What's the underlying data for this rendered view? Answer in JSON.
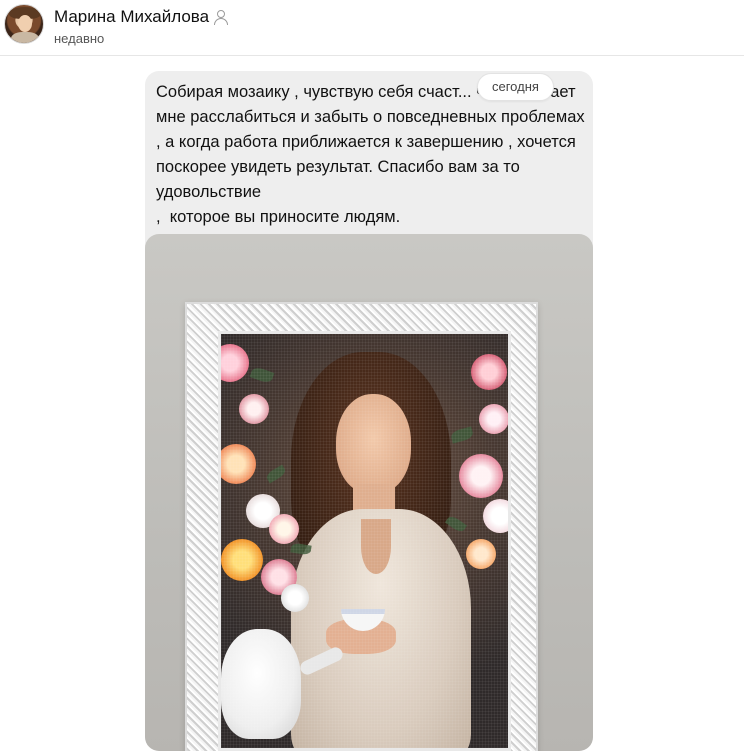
{
  "header": {
    "user_name": "Марина Михайлова",
    "status": "недавно"
  },
  "message": {
    "text": "Собирая мозаику , чувствую себя счаст... что помогает мне расслабиться и забыть о повседневных проблемах , а когда работа приближается к завершению , хочется поскорее увидеть результат. Спасибо вам за то удовольствие\n,  которое вы приносите людям.",
    "date_chip": "сегодня"
  },
  "icons": {
    "user_status_icon": "user-outline-icon"
  },
  "colors": {
    "bubble_bg": "#eeeeee",
    "header_divider": "#e6e6e6"
  }
}
